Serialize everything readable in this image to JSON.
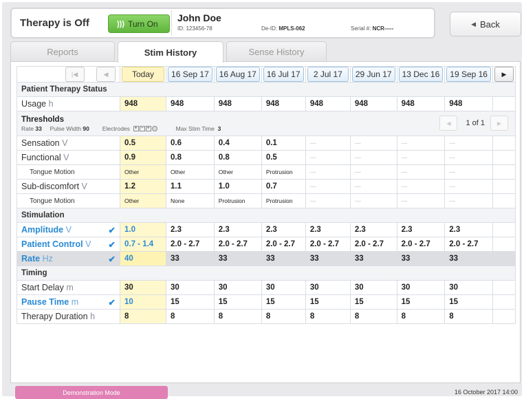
{
  "header": {
    "therapy_status": "Therapy is Off",
    "turn_on_label": "Turn On",
    "patient_name": "John Doe",
    "patient_id": "ID: 123456-78",
    "deid_label": "De-ID:",
    "deid_value": "MPLS-062",
    "serial_label": "Serial #:",
    "serial_value": "NCR-----",
    "back_label": "Back"
  },
  "tabs": [
    {
      "label": "Reports",
      "active": false
    },
    {
      "label": "Stim History",
      "active": true
    },
    {
      "label": "Sense History",
      "active": false
    }
  ],
  "dates": [
    "Today",
    "16 Sep 17",
    "16 Aug 17",
    "16 Jul 17",
    "2 Jul 17",
    "29 Jun 17",
    "13 Dec 16",
    "19 Sep 16"
  ],
  "sections": {
    "therapy_status": "Patient Therapy Status",
    "stimulation": "Stimulation",
    "timing": "Timing"
  },
  "usage": {
    "label": "Usage",
    "unit": "h",
    "values": [
      "948",
      "948",
      "948",
      "948",
      "948",
      "948",
      "948",
      "948"
    ]
  },
  "thresholds": {
    "title": "Thresholds",
    "rate_label": "Rate",
    "rate_value": "33",
    "pulse_label": "Pulse Width",
    "pulse_value": "90",
    "electrodes_label": "Electrodes",
    "max_label": "Max Stim Time",
    "max_value": "3",
    "page": "1 of 1"
  },
  "rows": {
    "sensation": {
      "label": "Sensation",
      "unit": "V",
      "values": [
        "0.5",
        "0.6",
        "0.4",
        "0.1",
        "---",
        "---",
        "---",
        "---"
      ]
    },
    "functional": {
      "label": "Functional",
      "unit": "V",
      "values": [
        "0.9",
        "0.8",
        "0.8",
        "0.5",
        "---",
        "---",
        "---",
        "---"
      ]
    },
    "tongue1": {
      "label": "Tongue Motion",
      "values": [
        "Other",
        "Other",
        "Other",
        "Protrusion",
        "---",
        "---",
        "---",
        "---"
      ]
    },
    "subdiscomfort": {
      "label": "Sub-discomfort",
      "unit": "V",
      "values": [
        "1.2",
        "1.1",
        "1.0",
        "0.7",
        "---",
        "---",
        "---",
        "---"
      ]
    },
    "tongue2": {
      "label": "Tongue Motion",
      "values": [
        "Other",
        "None",
        "Protrusion",
        "Protrusion",
        "---",
        "---",
        "---",
        "---"
      ]
    },
    "amplitude": {
      "label": "Amplitude",
      "unit": "V",
      "values": [
        "1.0",
        "2.3",
        "2.3",
        "2.3",
        "2.3",
        "2.3",
        "2.3",
        "2.3"
      ]
    },
    "patient_control": {
      "label": "Patient Control",
      "unit": "V",
      "values": [
        "0.7 - 1.4",
        "2.0 - 2.7",
        "2.0 - 2.7",
        "2.0 - 2.7",
        "2.0 - 2.7",
        "2.0 - 2.7",
        "2.0 - 2.7",
        "2.0 - 2.7"
      ]
    },
    "rate": {
      "label": "Rate",
      "unit": "Hz",
      "values": [
        "40",
        "33",
        "33",
        "33",
        "33",
        "33",
        "33",
        "33"
      ]
    },
    "start_delay": {
      "label": "Start Delay",
      "unit": "m",
      "values": [
        "30",
        "30",
        "30",
        "30",
        "30",
        "30",
        "30",
        "30"
      ]
    },
    "pause_time": {
      "label": "Pause Time",
      "unit": "m",
      "values": [
        "10",
        "15",
        "15",
        "15",
        "15",
        "15",
        "15",
        "15"
      ]
    },
    "therapy_duration": {
      "label": "Therapy Duration",
      "unit": "h",
      "values": [
        "8",
        "8",
        "8",
        "8",
        "8",
        "8",
        "8",
        "8"
      ]
    }
  },
  "footer": {
    "demo_label": "Demonstration Mode",
    "datetime": "16 October 2017 14:00"
  },
  "colors": {
    "accent": "#2a8ad4",
    "today": "#fff8cc",
    "turn_on": "#6cc046",
    "demo": "#e080b4"
  },
  "icons": {
    "turn_on": "wireless-signal-icon",
    "back": "triangle-left-icon",
    "first": "skip-first-icon",
    "prev": "triangle-left-icon",
    "next": "triangle-right-icon",
    "check": "checkmark-icon"
  }
}
